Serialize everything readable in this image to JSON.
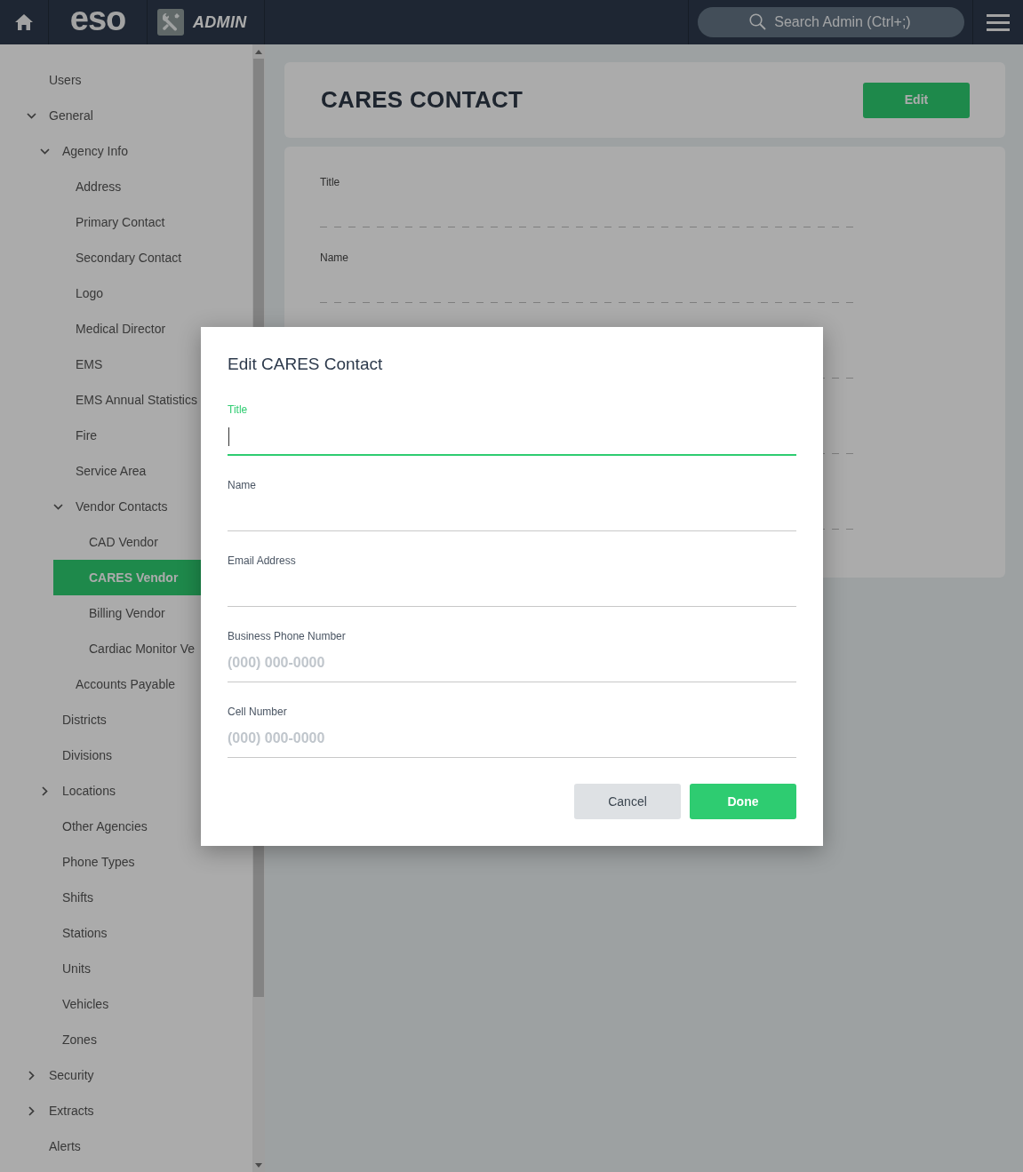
{
  "top_bar": {
    "logo": "eso",
    "app_name": "ADMIN",
    "search": {
      "placeholder": "Search Admin (Ctrl+;)"
    }
  },
  "sidebar": {
    "items": [
      {
        "label": "Users",
        "selected": false
      },
      {
        "label": "General",
        "selected": false,
        "expanded": true,
        "children": [
          {
            "label": "Agency Info",
            "selected": false,
            "expanded": true,
            "children": [
              {
                "label": "Address",
                "selected": false
              },
              {
                "label": "Primary Contact",
                "selected": false
              },
              {
                "label": "Secondary Contact",
                "selected": false
              },
              {
                "label": "Logo",
                "selected": false
              },
              {
                "label": "Medical Director",
                "selected": false
              },
              {
                "label": "EMS",
                "selected": false
              },
              {
                "label": "EMS Annual Statistics",
                "selected": false
              },
              {
                "label": "Fire",
                "selected": false
              },
              {
                "label": "Service Area",
                "selected": false
              },
              {
                "label": "Vendor Contacts",
                "selected": false,
                "expanded": true,
                "children": [
                  {
                    "label": "CAD Vendor",
                    "selected": false
                  },
                  {
                    "label": "CARES Vendor",
                    "selected": true
                  },
                  {
                    "label": "Billing Vendor",
                    "selected": false
                  },
                  {
                    "label": "Cardiac Monitor Ve",
                    "selected": false
                  }
                ]
              },
              {
                "label": "Accounts Payable",
                "selected": false
              }
            ]
          },
          {
            "label": "Districts",
            "selected": false
          },
          {
            "label": "Divisions",
            "selected": false
          },
          {
            "label": "Locations",
            "selected": false,
            "expanded": false
          },
          {
            "label": "Other Agencies",
            "selected": false
          },
          {
            "label": "Phone Types",
            "selected": false
          },
          {
            "label": "Shifts",
            "selected": false
          },
          {
            "label": "Stations",
            "selected": false
          },
          {
            "label": "Units",
            "selected": false
          },
          {
            "label": "Vehicles",
            "selected": false
          },
          {
            "label": "Zones",
            "selected": false
          }
        ]
      },
      {
        "label": "Security",
        "selected": false,
        "expanded": false
      },
      {
        "label": "Extracts",
        "selected": false,
        "expanded": false
      },
      {
        "label": "Alerts",
        "selected": false
      }
    ]
  },
  "page": {
    "title": "CARES CONTACT",
    "edit_button": "Edit",
    "fields": [
      {
        "label": "Title"
      },
      {
        "label": "Name"
      }
    ]
  },
  "dialog": {
    "title": "Edit CARES Contact",
    "fields": [
      {
        "label": "Title",
        "focused": true
      },
      {
        "label": "Name",
        "focused": false
      },
      {
        "label": "Email Address",
        "focused": false
      },
      {
        "label": "Business Phone Number",
        "focused": false,
        "placeholder": "(000) 000-0000"
      },
      {
        "label": "Cell Number",
        "focused": false,
        "placeholder": "(000) 000-0000"
      }
    ],
    "buttons": [
      {
        "label": "Cancel",
        "kind": "secondary"
      },
      {
        "label": "Done",
        "kind": "primary"
      }
    ]
  }
}
